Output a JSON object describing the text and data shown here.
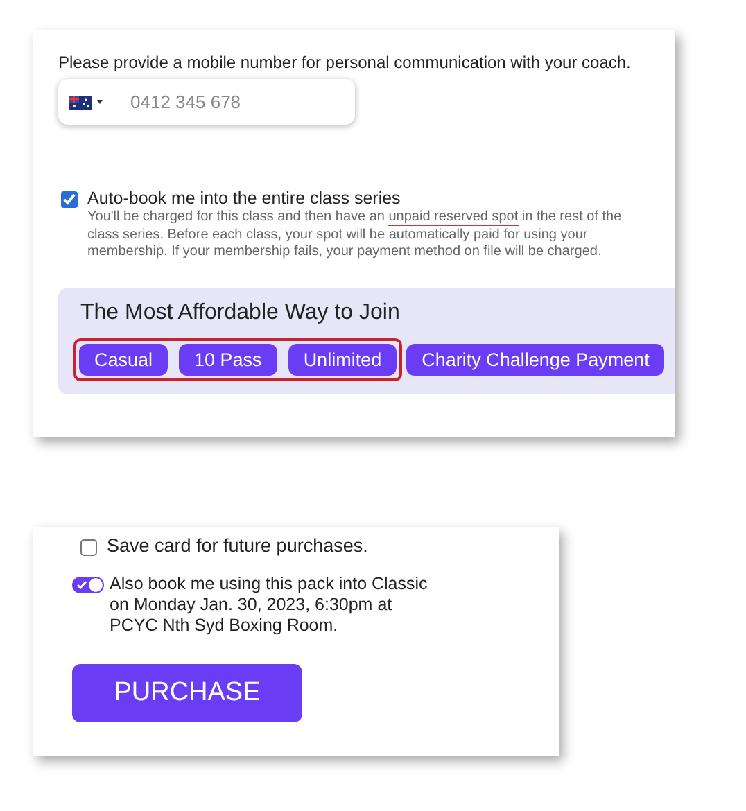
{
  "contact_card": {
    "prompt": "Please provide a mobile number for personal communication with your coach.",
    "phone": {
      "placeholder": "0412 345 678"
    },
    "auto_book": {
      "checked": true,
      "label": "Auto-book me into the entire class series",
      "description": [
        {
          "text": "You'll be charged for this class and then have an ",
          "underlined": false
        },
        {
          "text": "unpaid reserved spot",
          "underlined": true
        },
        {
          "text": " in the rest of the class series. Before each class, your spot will be automatically paid for using your membership. If your membership fails, your payment method on file will be charged.",
          "underlined": false
        }
      ]
    },
    "join_panel": {
      "title": "The Most Affordable Way to Join",
      "circled_options": [
        "Casual",
        "10 Pass",
        "Unlimited"
      ],
      "other_options": [
        "Charity Challenge Payment"
      ]
    }
  },
  "purchase_card": {
    "save_card": {
      "checked": false,
      "label": "Save card for future purchases."
    },
    "also_book": {
      "on": true,
      "label": "Also book me using this pack into Classic on Monday Jan. 30, 2023, 6:30pm at PCYC Nth Syd Boxing Room."
    },
    "button": "PURCHASE"
  }
}
